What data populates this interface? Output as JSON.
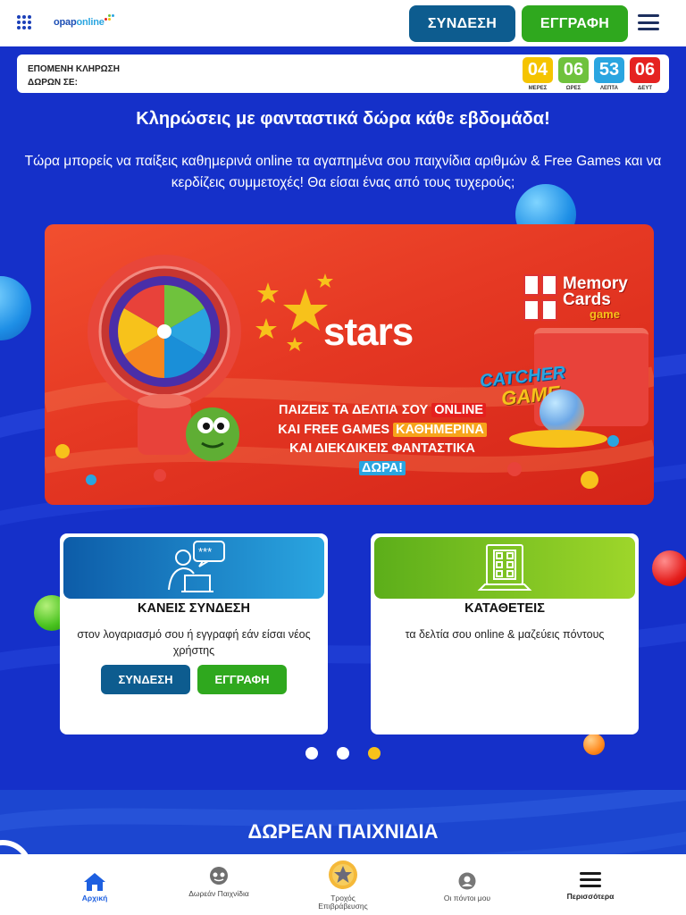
{
  "header": {
    "apps_icon": "apps-grid-icon",
    "logo_text_a": "opap",
    "logo_text_b": "online",
    "login_label": "ΣΥΝΔΕΣΗ",
    "register_label": "ΕΓΓΡΑΦΗ",
    "menu_icon": "hamburger-menu-icon"
  },
  "countdown": {
    "label": "ΕΠΟΜΕΝΗ ΚΛΗΡΩΣΗ ΔΩΡΩΝ ΣΕ:",
    "units": [
      {
        "value": "04",
        "label": "ΜΕΡΕΣ",
        "color": "#f5c400"
      },
      {
        "value": "06",
        "label": "ΩΡΕΣ",
        "color": "#6fc23d"
      },
      {
        "value": "53",
        "label": "ΛΕΠΤΑ",
        "color": "#2aa5e0"
      },
      {
        "value": "06",
        "label": "ΔΕΥΤ",
        "color": "#e52321"
      }
    ]
  },
  "hero": {
    "title": "Κληρώσεις με φανταστικά δώρα κάθε εβδομάδα!",
    "subtitle": "Τώρα μπορείς να παίξεις καθημερινά online τα αγαπημένα σου παιχνίδια αριθμών & Free Games και να κερδίζεις συμμετοχές! Θα είσαι ένας από τους τυχερούς;"
  },
  "banner": {
    "brand": "stars",
    "memory_line1": "Memory",
    "memory_line2": "Cards",
    "memory_line3": "game",
    "catcher_line1": "CATCHER",
    "catcher_line2": "GAME",
    "line1_text": "ΠΑΙΖΕΙΣ ΤΑ ΔΕΛΤΙΑ ΣΟΥ",
    "line1_tag": "ONLINE",
    "line2_text": "ΚΑΙ FREE GAMES",
    "line2_tag": "ΚΑΘΗΜΕΡΙΝΑ",
    "line3_text": "ΚΑΙ ΔΙΕΚΔΙΚΕΙΣ ΦΑΝΤΑΣΤΙΚΑ",
    "line3_tag": "ΔΩΡΑ!"
  },
  "cards": [
    {
      "title": "ΚΑΝΕΙΣ ΣΥΝΔΕΣΗ",
      "desc": "στον λογαριασμό σου ή εγγραφή εάν είσαι νέος χρήστης",
      "icon": "user-login-icon",
      "login_label": "ΣΥΝΔΕΣΗ",
      "register_label": "ΕΓΓΡΑΦΗ"
    },
    {
      "title": "ΚΑΤΑΘΕΤΕΙΣ",
      "desc": "τα δελτία σου online & μαζεύεις πόντους",
      "icon": "laptop-ticket-icon"
    }
  ],
  "carousel": {
    "pages": 3,
    "active": 3
  },
  "section2": {
    "title": "ΔΩΡΕΑΝ ΠΑΙΧΝΙΔΙΑ"
  },
  "bottom_nav": [
    {
      "label": "Αρχική",
      "icon": "home-icon",
      "active": true
    },
    {
      "label": "Δωρεάν Παιχνίδια",
      "icon": "gamepad-icon",
      "active": false
    },
    {
      "label": "Τροχός Επιβράβευσης",
      "icon": "star-wheel-icon",
      "active": false
    },
    {
      "label": "Οι πόντοι μου",
      "icon": "user-points-icon",
      "active": false
    },
    {
      "label": "Περισσότερα",
      "icon": "menu-icon",
      "active": false
    }
  ],
  "colors": {
    "page_bg": "#1530c9",
    "login_blue": "#0d5c8f",
    "register_green": "#2fa81e",
    "banner_red": "#e53823"
  }
}
